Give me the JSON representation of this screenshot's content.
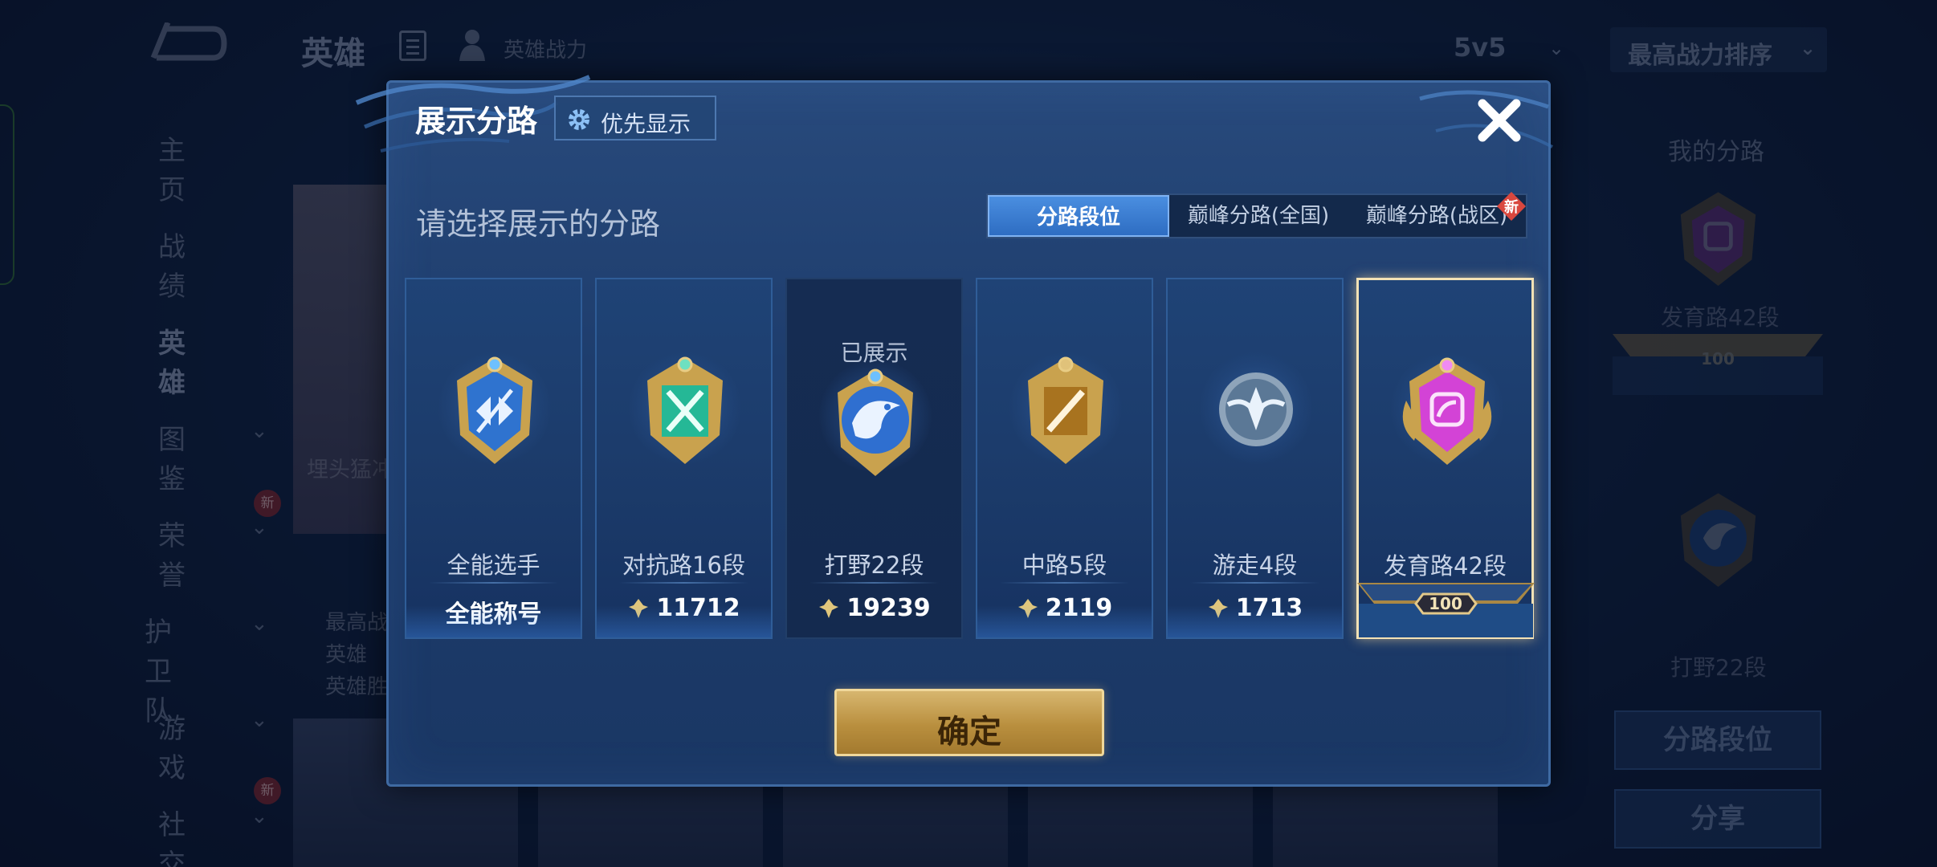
{
  "background": {
    "title": "英雄",
    "power_label": "英雄战力",
    "mode": "5v5",
    "sort": "最高战力排序",
    "nav": [
      "主页",
      "战绩",
      "英雄",
      "图鉴",
      "荣誉",
      "护卫队",
      "游戏",
      "社交"
    ],
    "new_badge": "新",
    "card_text": "埋头猛冲",
    "stats": [
      "最高战",
      "英雄",
      "英雄胜"
    ],
    "right_panel": {
      "title": "我的分路",
      "lane1": "发育路42段",
      "lane1_level": "100",
      "lane2": "打野22段",
      "btn_lane_rank": "分路段位",
      "btn_share": "分享"
    }
  },
  "modal": {
    "title": "展示分路",
    "priority_button": "优先显示",
    "subtitle": "请选择展示的分路",
    "tabs": [
      {
        "label": "分路段位",
        "active": true
      },
      {
        "label": "巅峰分路(全国)",
        "active": false
      },
      {
        "label": "巅峰分路(战区)",
        "active": false,
        "new": "新"
      }
    ],
    "cards": [
      {
        "name": "全能选手",
        "value": "全能称号",
        "has_bolt": false,
        "badge_icon": "all-round-badge-icon",
        "color": "#3f8fe8"
      },
      {
        "name": "对抗路16段",
        "value": "11712",
        "has_bolt": true,
        "badge_icon": "clash-lane-badge-icon",
        "color": "#2fc7a3"
      },
      {
        "name": "打野22段",
        "value": "19239",
        "has_bolt": true,
        "shown": "已展示",
        "badge_icon": "jungle-badge-icon",
        "color": "#3a7de0"
      },
      {
        "name": "中路5段",
        "value": "2119",
        "has_bolt": true,
        "badge_icon": "mid-lane-badge-icon",
        "color": "#c9953a"
      },
      {
        "name": "游走4段",
        "value": "1713",
        "has_bolt": true,
        "badge_icon": "roam-badge-icon",
        "color": "#9fb4c8"
      },
      {
        "name": "发育路42段",
        "value": "100",
        "has_bolt": false,
        "selected": true,
        "badge_icon": "farm-lane-badge-icon",
        "color": "#d34bd6"
      }
    ],
    "confirm": "确定"
  },
  "colors": {
    "modal_bg": "#1e3d6d",
    "accent_blue": "#2e6dc2",
    "gold": "#c9a24e",
    "selected_border": "#f4e2b5"
  }
}
